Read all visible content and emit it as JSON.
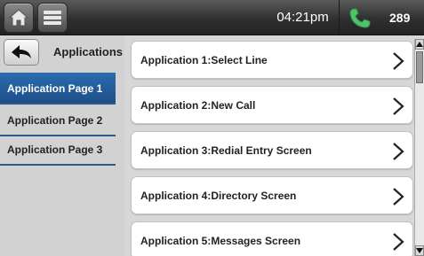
{
  "status_bar": {
    "time": "04:21pm",
    "extension": "289",
    "icons": [
      "home-icon",
      "menu-icon",
      "phone-icon"
    ],
    "phone_color": "#4fc36a"
  },
  "sidebar": {
    "title": "Applications",
    "back_icon": "back-arrow-icon",
    "items": [
      {
        "label": "Application Page 1",
        "selected": true
      },
      {
        "label": "Application Page 2",
        "selected": false
      },
      {
        "label": "Application Page 3",
        "selected": false
      }
    ]
  },
  "applications": [
    {
      "label": "Application 1:Select Line"
    },
    {
      "label": "Application 2:New Call"
    },
    {
      "label": "Application 3:Redial Entry Screen"
    },
    {
      "label": "Application 4:Directory Screen"
    },
    {
      "label": "Application 5:Messages Screen"
    }
  ],
  "colors": {
    "accent": "#2a6cb0",
    "topbar": "#2f2f2f",
    "background": "#d7d7d7"
  }
}
